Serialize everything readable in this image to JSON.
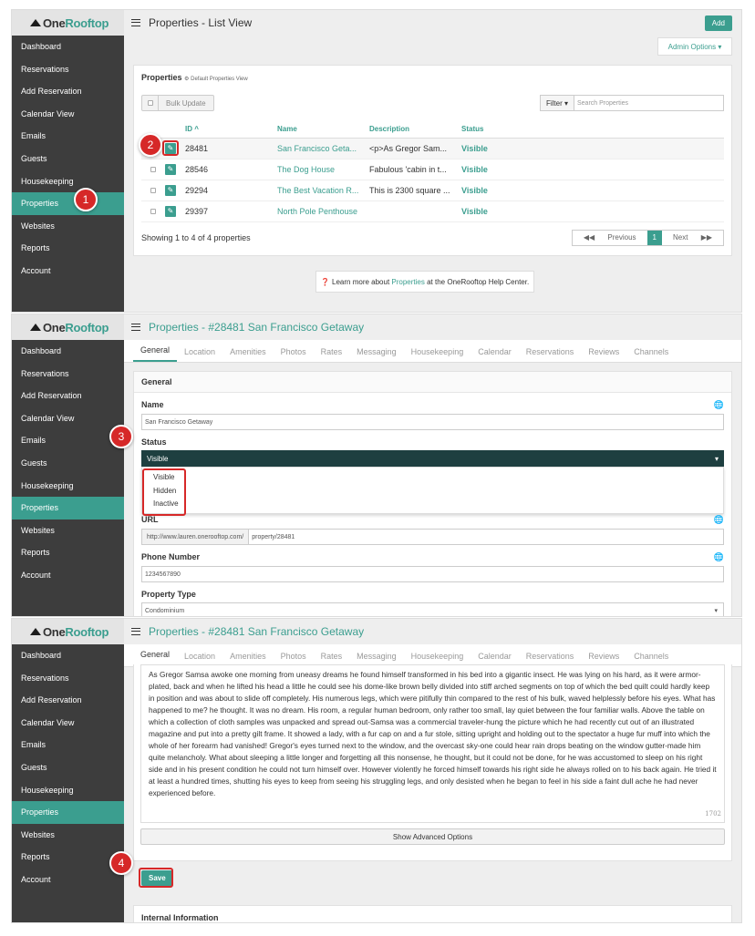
{
  "brand": {
    "logo_prefix": "One",
    "logo_suffix": "Rooftop",
    "accent_color": "#3b9e8f",
    "sidebar_bg": "#3d3d3d"
  },
  "sidebar": {
    "items": [
      "Dashboard",
      "Reservations",
      "Add Reservation",
      "Calendar View",
      "Emails",
      "Guests",
      "Housekeeping",
      "Properties",
      "Websites",
      "Reports",
      "Account"
    ],
    "active": "Properties"
  },
  "list_view": {
    "title": "Properties - List View",
    "add_label": "Add",
    "admin_options_label": "Admin Options",
    "card_title": "Properties",
    "card_subtitle": "Default Properties View",
    "bulk_update_label": "Bulk Update",
    "filter_label": "Filter",
    "search_placeholder": "Search Properties",
    "columns": [
      "ID",
      "Name",
      "Description",
      "Status"
    ],
    "rows": [
      {
        "id": "28481",
        "name": "San Francisco Geta...",
        "desc": "<p>As Gregor Sam...",
        "status": "Visible"
      },
      {
        "id": "28546",
        "name": "The Dog House",
        "desc": "Fabulous 'cabin in t...",
        "status": "Visible"
      },
      {
        "id": "29294",
        "name": "The Best Vacation R...",
        "desc": "This is 2300 square ...",
        "status": "Visible"
      },
      {
        "id": "29397",
        "name": "North Pole Penthouse",
        "desc": "",
        "status": "Visible"
      }
    ],
    "showing_text": "Showing 1 to 4 of 4 properties",
    "pager": {
      "prev": "Previous",
      "current": "1",
      "next": "Next"
    },
    "help": {
      "before": "Learn more about",
      "link": "Properties",
      "after": "at the OneRooftop Help Center."
    }
  },
  "edit_view": {
    "title": "Properties - #28481 San Francisco Getaway",
    "tabs": [
      "General",
      "Location",
      "Amenities",
      "Photos",
      "Rates",
      "Messaging",
      "Housekeeping",
      "Calendar",
      "Reservations",
      "Reviews",
      "Channels"
    ],
    "section_title": "General",
    "name_label": "Name",
    "name_value": "San Francisco Getaway",
    "status_label": "Status",
    "status_value": "Visible",
    "status_options": [
      "Visible",
      "Hidden",
      "Inactive"
    ],
    "url_label": "URL",
    "url_prefix": "http://www.lauren.onerooftop.com/",
    "url_value": "property/28481",
    "phone_label": "Phone Number",
    "phone_value": "1234567890",
    "type_label": "Property Type",
    "type_value": "Condominium"
  },
  "save_view": {
    "description": "As Gregor Samsa awoke one morning from uneasy dreams  he found himself transformed in his bed into a gigantic insect. He was lying on his hard, as it were armor-plated, back and when he lifted his head a little he could see his dome-like brown belly divided into stiff arched segments on top of which the bed quilt could hardly keep in position and was about to slide off completely. His numerous legs, which were pitifully thin compared to the rest of his bulk, waved helplessly before his eyes. What has happened to me? he thought. It was no dream. His room, a regular human bedroom, only rather too small, lay quiet between the four familiar walls. Above the table on which a collection of cloth samples was unpacked and spread out-Samsa was a commercial traveler-hung the picture which he had recently cut out of an illustrated magazine and put into a pretty gilt frame. It showed a lady, with a fur cap on and a fur stole, sitting upright and holding out to the spectator a huge fur muff into which the whole of her forearm had vanished! Gregor's eyes turned next to the window, and the overcast sky-one could hear rain drops beating on the window gutter-made him quite melancholy. What about sleeping a little longer and forgetting all this nonsense, he thought, but it could not be done, for he was accustomed to sleep on his right side and in his present condition he could not turn himself over. However violently he forced himself towards his right side he always rolled on to his back again. He tried it at least a hundred times, shutting his eyes to keep from seeing his struggling legs, and only desisted when he began to feel in his side a faint dull ache he had never experienced before.",
    "char_count": "1702",
    "advanced_label": "Show Advanced Options",
    "save_label": "Save",
    "internal_label": "Internal Information"
  },
  "markers": [
    "1",
    "2",
    "3",
    "4"
  ]
}
